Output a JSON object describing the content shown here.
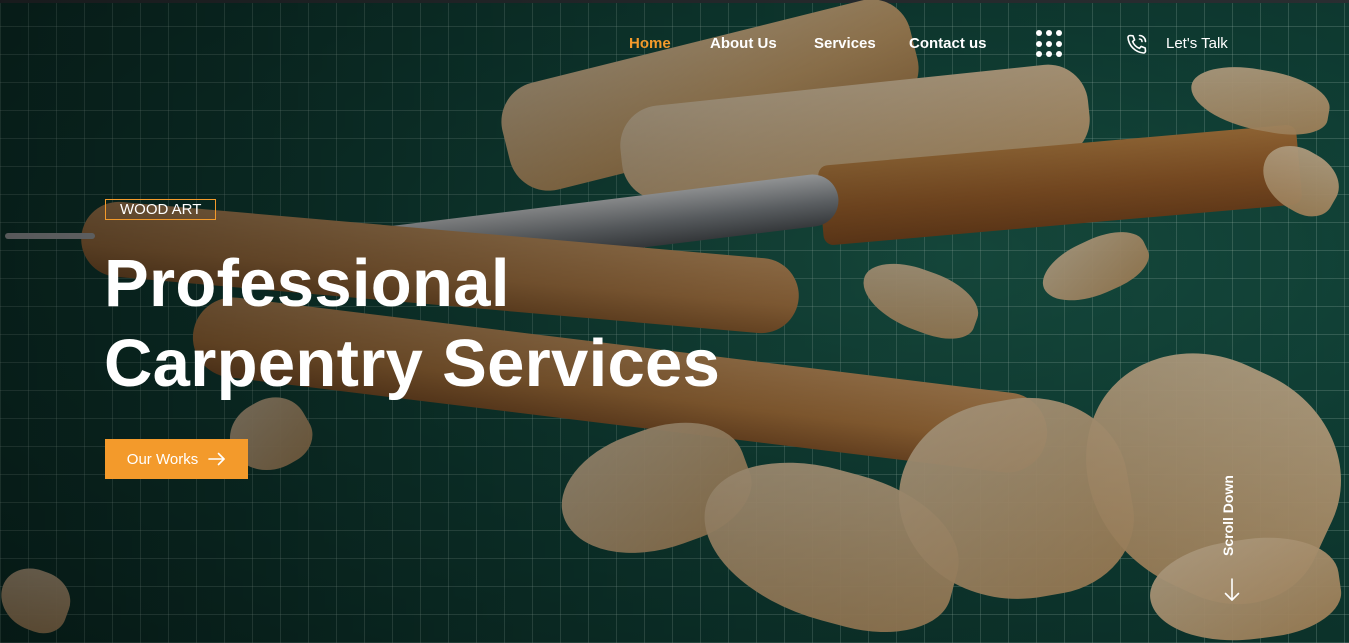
{
  "nav": {
    "items": [
      {
        "label": "Home",
        "active": true
      },
      {
        "label": "About Us",
        "active": false
      },
      {
        "label": "Services",
        "active": false
      },
      {
        "label": "Contact us",
        "active": false
      }
    ],
    "menu_icon": "dots-grid-icon",
    "phone_icon": "phone-icon",
    "cta_label": "Let's Talk"
  },
  "hero": {
    "eyebrow": "WOOD ART",
    "headline_line1": "Professional",
    "headline_line2": "Carpentry Services",
    "button_label": "Our Works",
    "button_icon": "arrow-right-icon",
    "background_image": "wood carving chisels and shavings on green cutting mat"
  },
  "scroll": {
    "label": "Scroll Down",
    "icon": "arrow-down-icon"
  },
  "colors": {
    "accent": "#f39a2b",
    "text": "#ffffff",
    "mat_green": "#145245"
  }
}
